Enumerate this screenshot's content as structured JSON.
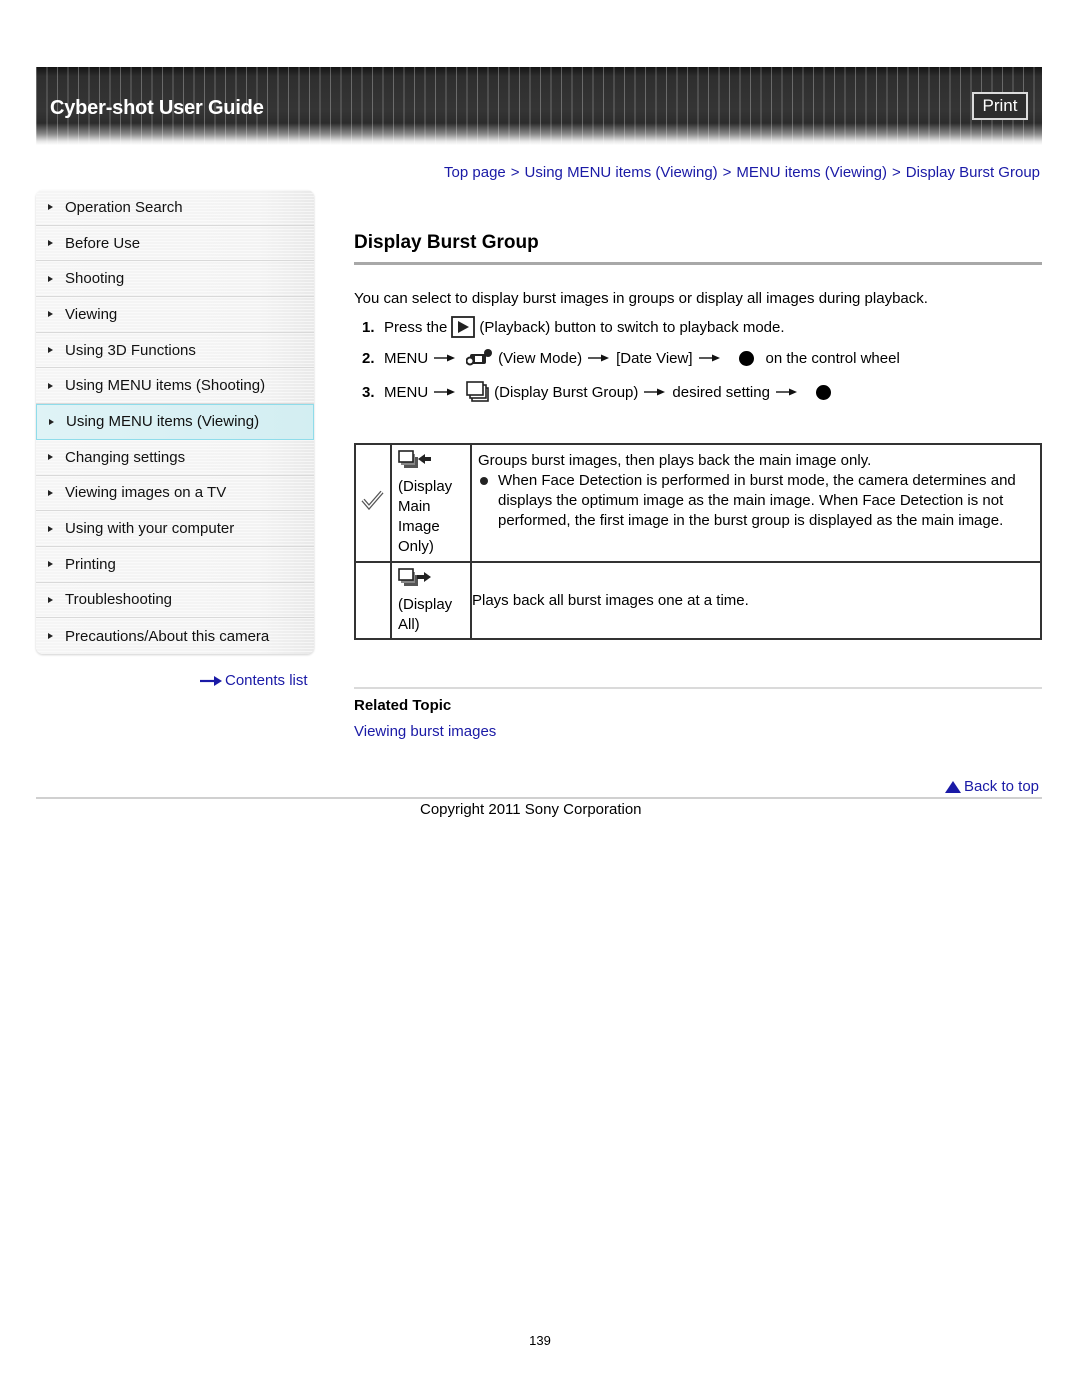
{
  "header": {
    "title": "Cyber-shot User Guide",
    "print_label": "Print"
  },
  "sidebar": {
    "items": [
      {
        "label": "Operation Search",
        "active": false
      },
      {
        "label": "Before Use",
        "active": false
      },
      {
        "label": "Shooting",
        "active": false
      },
      {
        "label": "Viewing",
        "active": false
      },
      {
        "label": "Using 3D Functions",
        "active": false
      },
      {
        "label": "Using MENU items (Shooting)",
        "active": false
      },
      {
        "label": "Using MENU items (Viewing)",
        "active": true
      },
      {
        "label": "Changing settings",
        "active": false
      },
      {
        "label": "Viewing images on a TV",
        "active": false
      },
      {
        "label": "Using with your computer",
        "active": false
      },
      {
        "label": "Printing",
        "active": false
      },
      {
        "label": "Troubleshooting",
        "active": false
      },
      {
        "label": "Precautions/About this camera",
        "active": false
      }
    ],
    "contents_link": "Contents list"
  },
  "breadcrumb": {
    "items": [
      "Top page",
      "Using MENU items (Viewing)",
      "MENU items (Viewing)",
      "Display Burst Group"
    ],
    "separator": ">"
  },
  "page": {
    "title": "Display Burst Group",
    "intro": "You can select to display burst images in groups or display all images during playback.",
    "steps": [
      {
        "num": "1.",
        "pre": "Press the",
        "icon": "playback-icon",
        "post": "(Playback) button to switch to playback mode."
      },
      {
        "num": "2.",
        "menu": "MENU",
        "icon": "view-mode-icon",
        "label": "(View Mode)",
        "option": "[Date View]",
        "tail": "on the control wheel"
      },
      {
        "num": "3.",
        "menu": "MENU",
        "icon": "display-burst-group-icon",
        "label": "(Display Burst Group)",
        "option": "desired setting"
      }
    ]
  },
  "table": {
    "rows": [
      {
        "default": true,
        "icon": "display-main-image-only-icon",
        "name": "(Display Main Image Only)",
        "name_lines": [
          "(Display",
          "Main",
          "Image",
          "Only)"
        ],
        "description": "Groups burst images, then plays back the main image only.",
        "bullet": "When Face Detection is performed in burst mode, the camera determines and displays the optimum image as the main image. When Face Detection is not performed, the first image in the burst group is displayed as the main image."
      },
      {
        "default": false,
        "icon": "display-all-icon",
        "name": "(Display All)",
        "name_lines": [
          "(Display",
          "All)"
        ],
        "description": "Plays back all burst images one at a time."
      }
    ]
  },
  "related": {
    "title": "Related Topic",
    "links": [
      "Viewing burst images"
    ]
  },
  "footer": {
    "back_to_top": "Back to top",
    "copyright": "Copyright 2011 Sony Corporation",
    "page_number": "139"
  },
  "colors": {
    "link": "#1a1aa6",
    "active_nav_bg": "#d3eef2",
    "active_nav_border": "#8fdcea",
    "header_bg": "#333333"
  }
}
